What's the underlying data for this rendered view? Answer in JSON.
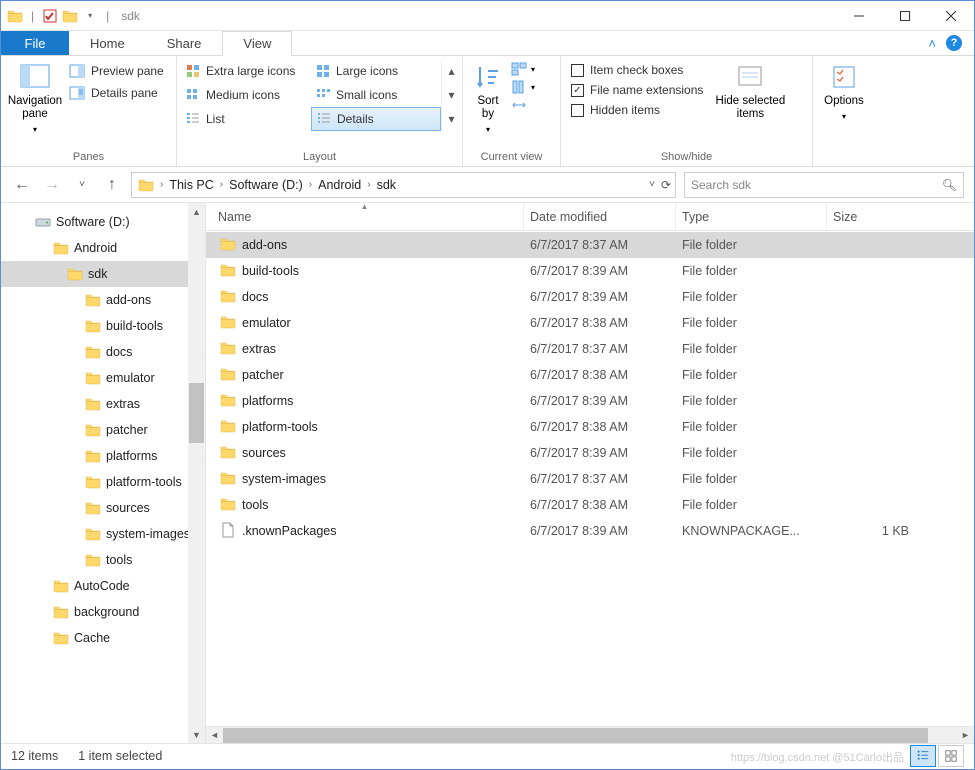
{
  "title": "sdk",
  "tabs": {
    "file": "File",
    "home": "Home",
    "share": "Share",
    "view": "View"
  },
  "ribbon": {
    "panes": {
      "nav": "Navigation\npane",
      "preview": "Preview pane",
      "details": "Details pane",
      "label": "Panes"
    },
    "layout": {
      "xl": "Extra large icons",
      "lg": "Large icons",
      "md": "Medium icons",
      "sm": "Small icons",
      "list": "List",
      "details": "Details",
      "label": "Layout"
    },
    "current_view": {
      "sort": "Sort\nby",
      "label": "Current view"
    },
    "showhide": {
      "checkboxes": "Item check boxes",
      "ext": "File name extensions",
      "hidden": "Hidden items",
      "hide_sel": "Hide selected\nitems",
      "label": "Show/hide",
      "ext_checked": true
    },
    "options": "Options"
  },
  "breadcrumbs": [
    "This PC",
    "Software (D:)",
    "Android",
    "sdk"
  ],
  "search_placeholder": "Search sdk",
  "columns": {
    "name": "Name",
    "date": "Date modified",
    "type": "Type",
    "size": "Size"
  },
  "tree": [
    {
      "label": "Software (D:)",
      "indent": 1,
      "icon": "drive"
    },
    {
      "label": "Android",
      "indent": 2,
      "icon": "folder"
    },
    {
      "label": "sdk",
      "indent": 3,
      "icon": "folder",
      "selected": true
    },
    {
      "label": "add-ons",
      "indent": 4,
      "icon": "folder"
    },
    {
      "label": "build-tools",
      "indent": 4,
      "icon": "folder"
    },
    {
      "label": "docs",
      "indent": 4,
      "icon": "folder"
    },
    {
      "label": "emulator",
      "indent": 4,
      "icon": "folder"
    },
    {
      "label": "extras",
      "indent": 4,
      "icon": "folder"
    },
    {
      "label": "patcher",
      "indent": 4,
      "icon": "folder"
    },
    {
      "label": "platforms",
      "indent": 4,
      "icon": "folder"
    },
    {
      "label": "platform-tools",
      "indent": 4,
      "icon": "folder"
    },
    {
      "label": "sources",
      "indent": 4,
      "icon": "folder"
    },
    {
      "label": "system-images",
      "indent": 4,
      "icon": "folder"
    },
    {
      "label": "tools",
      "indent": 4,
      "icon": "folder"
    },
    {
      "label": "AutoCode",
      "indent": 2,
      "icon": "folder"
    },
    {
      "label": "background",
      "indent": 2,
      "icon": "folder"
    },
    {
      "label": "Cache",
      "indent": 2,
      "icon": "folder"
    }
  ],
  "rows": [
    {
      "name": "add-ons",
      "date": "6/7/2017 8:37 AM",
      "type": "File folder",
      "size": "",
      "icon": "folder",
      "selected": true
    },
    {
      "name": "build-tools",
      "date": "6/7/2017 8:39 AM",
      "type": "File folder",
      "size": "",
      "icon": "folder"
    },
    {
      "name": "docs",
      "date": "6/7/2017 8:39 AM",
      "type": "File folder",
      "size": "",
      "icon": "folder"
    },
    {
      "name": "emulator",
      "date": "6/7/2017 8:38 AM",
      "type": "File folder",
      "size": "",
      "icon": "folder"
    },
    {
      "name": "extras",
      "date": "6/7/2017 8:37 AM",
      "type": "File folder",
      "size": "",
      "icon": "folder"
    },
    {
      "name": "patcher",
      "date": "6/7/2017 8:38 AM",
      "type": "File folder",
      "size": "",
      "icon": "folder"
    },
    {
      "name": "platforms",
      "date": "6/7/2017 8:39 AM",
      "type": "File folder",
      "size": "",
      "icon": "folder"
    },
    {
      "name": "platform-tools",
      "date": "6/7/2017 8:38 AM",
      "type": "File folder",
      "size": "",
      "icon": "folder"
    },
    {
      "name": "sources",
      "date": "6/7/2017 8:39 AM",
      "type": "File folder",
      "size": "",
      "icon": "folder"
    },
    {
      "name": "system-images",
      "date": "6/7/2017 8:37 AM",
      "type": "File folder",
      "size": "",
      "icon": "folder"
    },
    {
      "name": "tools",
      "date": "6/7/2017 8:38 AM",
      "type": "File folder",
      "size": "",
      "icon": "folder"
    },
    {
      "name": ".knownPackages",
      "date": "6/7/2017 8:39 AM",
      "type": "KNOWNPACKAGE...",
      "size": "1 KB",
      "icon": "file"
    }
  ],
  "status": {
    "count": "12 items",
    "selected": "1 item selected"
  },
  "watermark": "https://blog.csdn.net  @51Carlo出品"
}
